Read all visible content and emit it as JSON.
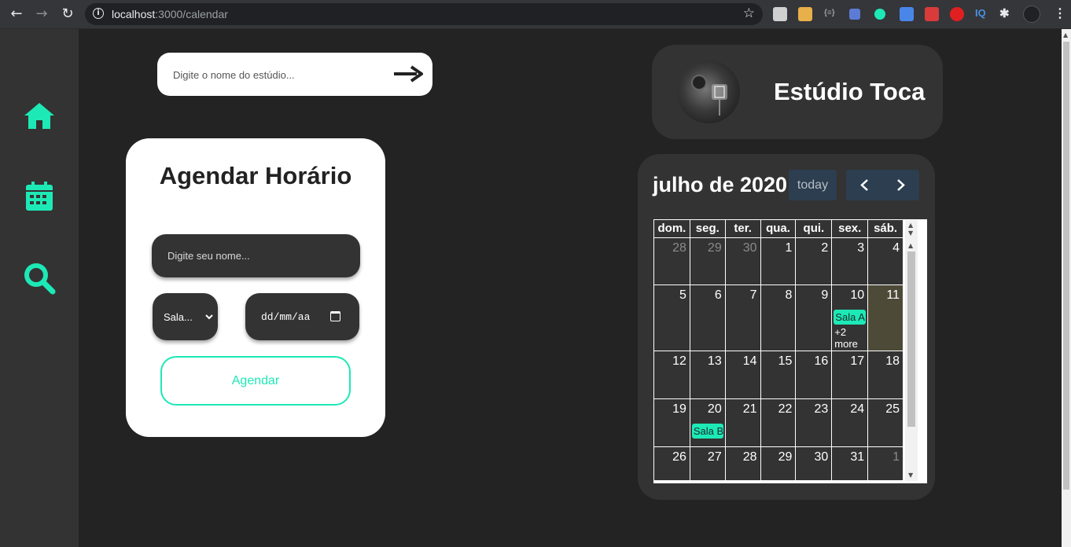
{
  "browser": {
    "url_host": "localhost",
    "url_path": ":3000/calendar",
    "extensions": [
      "toolbar-ext-1",
      "toolbar-ext-2",
      "toolbar-ext-3",
      "toolbar-ext-4",
      "toolbar-ext-5",
      "translate-ext",
      "toolbar-ext-7",
      "stop-ext",
      "IQ",
      "puzzle-ext",
      "profile-ext"
    ]
  },
  "sidebar": {
    "items": [
      {
        "name": "home",
        "icon": "home-icon"
      },
      {
        "name": "calendar",
        "icon": "calendar-icon"
      },
      {
        "name": "search",
        "icon": "search-icon"
      }
    ],
    "accent": "#1de9b6"
  },
  "search": {
    "placeholder": "Digite o nome do estúdio..."
  },
  "booking": {
    "title": "Agendar Horário",
    "name_placeholder": "Digite seu nome...",
    "room_value": "Sala...",
    "date_placeholder": "dd/mm/aa",
    "submit_label": "Agendar"
  },
  "profile": {
    "studio_name": "Estúdio Toca"
  },
  "calendar": {
    "title": "julho de 2020",
    "today_label": "today",
    "weekdays": [
      "dom.",
      "seg.",
      "ter.",
      "qua.",
      "qui.",
      "sex.",
      "sáb."
    ],
    "weeks": [
      [
        {
          "n": "28",
          "other": true
        },
        {
          "n": "29",
          "other": true
        },
        {
          "n": "30",
          "other": true
        },
        {
          "n": "1"
        },
        {
          "n": "2"
        },
        {
          "n": "3"
        },
        {
          "n": "4"
        }
      ],
      [
        {
          "n": "5"
        },
        {
          "n": "6"
        },
        {
          "n": "7"
        },
        {
          "n": "8"
        },
        {
          "n": "9"
        },
        {
          "n": "10",
          "event": "Sala A",
          "more": "+2 more"
        },
        {
          "n": "11",
          "today": true
        }
      ],
      [
        {
          "n": "12"
        },
        {
          "n": "13"
        },
        {
          "n": "14"
        },
        {
          "n": "15"
        },
        {
          "n": "16"
        },
        {
          "n": "17"
        },
        {
          "n": "18"
        }
      ],
      [
        {
          "n": "19"
        },
        {
          "n": "20",
          "event": "Sala B"
        },
        {
          "n": "21"
        },
        {
          "n": "22"
        },
        {
          "n": "23"
        },
        {
          "n": "24"
        },
        {
          "n": "25"
        }
      ],
      [
        {
          "n": "26"
        },
        {
          "n": "27"
        },
        {
          "n": "28"
        },
        {
          "n": "29"
        },
        {
          "n": "30"
        },
        {
          "n": "31"
        },
        {
          "n": "1",
          "other": true
        }
      ]
    ],
    "event_color": "#1de9b6",
    "today_color": "#4d4a38",
    "button_color": "#2c3e50"
  }
}
